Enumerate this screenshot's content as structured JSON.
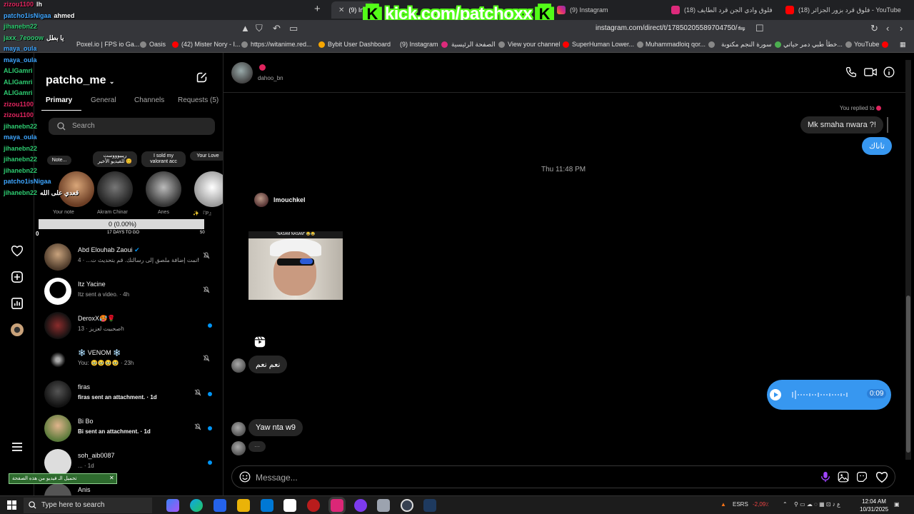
{
  "browser": {
    "tabs": [
      {
        "label": "(9) Inbox",
        "active": true
      },
      {
        "label": "(9) Instagram",
        "active": false
      },
      {
        "label": "(18) فلوق وادي الجن قرد الطايف",
        "active": false
      },
      {
        "label": "(18) فلوق قرد بزور الجزائر - YouTube",
        "active": false
      }
    ],
    "kick_banner": "kick.com/patchoxx",
    "url": "instagram.com/direct/t/17850205589704750/",
    "bookmarks": [
      "Poxel.io | FPS io Ga...",
      "Oasis",
      "(42) Mister Nory - I...",
      "https://witanime.red...",
      "Bybit User Dashboard",
      "(9) Instagram",
      "الصفحة الرئيسية",
      "View your channel",
      "SuperHuman Lower...",
      "Muhammadloiq qor...",
      "سورة النجم مكتوبة",
      "خطأ طبي دمر حياتي...",
      "YouTube"
    ]
  },
  "dm": {
    "account": "patcho_me",
    "tabs": [
      "Primary",
      "General",
      "Channels",
      "Requests (5)"
    ],
    "search_placeholder": "Search",
    "notes": [
      {
        "bubble": "Note...",
        "name": "Your note"
      },
      {
        "bubble": "ريبيوووست للفيديو الأخير 😊",
        "name": "Akram Chinar"
      },
      {
        "bubble": "I sold my valorant acc",
        "name": "Anes"
      },
      {
        "bubble": "Your Love",
        "name": "✨ 『P』"
      }
    ],
    "progress": {
      "label": "0 (0.00%)",
      "days": "17 DAYS TO GO",
      "left": "0",
      "right": "50",
      "fraction": 0.0
    },
    "conversations": [
      {
        "name": "Abd Elouhab Zaoui",
        "preview": "تمت إضافة ملصق إلى رسالتك. قم بتحديث ت... · 4h",
        "muted": true,
        "unread": false,
        "verified": true
      },
      {
        "name": "Itz Yacine",
        "preview": "Itz sent a video. · 4h",
        "muted": true,
        "unread": false
      },
      {
        "name": "DeroxX🥵🌹",
        "preview": "صحبيت لعزيز · 13h",
        "muted": false,
        "unread": true
      },
      {
        "name": "❄️ VENOM ❄️",
        "preview": "You: 🥹🥹🥹🥹 · 23h",
        "muted": true,
        "unread": false
      },
      {
        "name": "firas",
        "preview": "firas sent an attachment. · 1d",
        "muted": true,
        "unread": true
      },
      {
        "name": "Bi Bo",
        "preview": "Bi sent an attachment. · 1d",
        "muted": true,
        "unread": true
      },
      {
        "name": "soh_aib0087",
        "preview": "... · 1d",
        "muted": false,
        "unread": true
      },
      {
        "name": "Anis",
        "preview": "",
        "muted": false,
        "unread": false
      }
    ]
  },
  "chat": {
    "peer_username": "dahoo_bn",
    "replied_to": "You replied to",
    "reply_quote": "Mk smaha nwara ?!",
    "msg_out_1": "تاناك",
    "timestamp": "Thu 11:48 PM",
    "shared_from": "lmouchkel",
    "shared_caption": "\"NASAM NASAM\" 😂😂",
    "msg_in_1": "نعم نعم",
    "voice_duration": "0:09",
    "msg_in_2": "Yaw nta w9",
    "typing": "···",
    "composer_placeholder": "Message..."
  },
  "overlay": {
    "chat_lines": [
      {
        "user": "zizou1100",
        "text": "lh",
        "color": "#e0245e"
      },
      {
        "user": "patcho1isNigaa",
        "text": "ahmed",
        "color": "#3ea6ff"
      },
      {
        "user": "jihanebn22",
        "text": "",
        "color": "#2ecc71"
      },
      {
        "user": "jaxx_7eooow",
        "text": "يا بطل",
        "color": "#2ecc71"
      },
      {
        "user": "maya_oula",
        "text": "",
        "color": "#3ea6ff"
      },
      {
        "user": "maya_oula",
        "text": "",
        "color": "#3ea6ff"
      },
      {
        "user": "ALIGamri",
        "text": "",
        "color": "#2ecc71"
      },
      {
        "user": "ALIGamri",
        "text": "",
        "color": "#2ecc71"
      },
      {
        "user": "ALIGamri",
        "text": "",
        "color": "#2ecc71"
      },
      {
        "user": "zizou1100",
        "text": "",
        "color": "#e0245e"
      },
      {
        "user": "zizou1100",
        "text": "",
        "color": "#e0245e"
      },
      {
        "user": "jihanebn22",
        "text": "",
        "color": "#2ecc71"
      },
      {
        "user": "maya_oula",
        "text": "",
        "color": "#3ea6ff"
      },
      {
        "user": "jihanebn22",
        "text": "",
        "color": "#2ecc71"
      },
      {
        "user": "jihanebn22",
        "text": "",
        "color": "#2ecc71"
      },
      {
        "user": "jihanebn22",
        "text": "",
        "color": "#2ecc71"
      },
      {
        "user": "patcho1isNigaa",
        "text": "",
        "color": "#3ea6ff"
      },
      {
        "user": "jihanebn22",
        "text": "قعدي على الله",
        "color": "#2ecc71"
      }
    ],
    "video_bar": "تحميل الـ فيديو من هذه الصفحة"
  },
  "taskbar": {
    "search_placeholder": "Type here to search",
    "time": "12:04 AM",
    "date": "10/31/2025",
    "stock": "ESRS",
    "stock_change": "-2,09٪"
  },
  "colors": {
    "accent": "#3797f0",
    "unread": "#0095f6",
    "kick_green": "#53fc18"
  }
}
